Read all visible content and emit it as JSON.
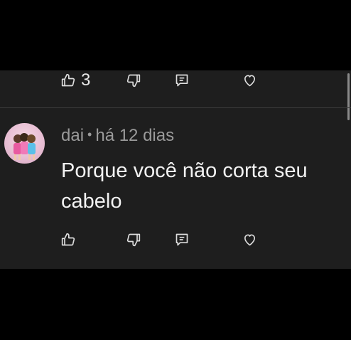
{
  "top_comment": {
    "like_count": "3"
  },
  "comment": {
    "author": "dai",
    "separator": "•",
    "time": "há 12 dias",
    "text_line1": "Porque você não corta seu",
    "text_line2": "cabelo"
  },
  "icons": {
    "like": "thumbs-up-icon",
    "dislike": "thumbs-down-icon",
    "reply": "reply-icon",
    "heart": "heart-icon"
  },
  "colors": {
    "background": "#1e1e1e",
    "text": "#f2f2f2",
    "meta": "#9a9a9a"
  }
}
